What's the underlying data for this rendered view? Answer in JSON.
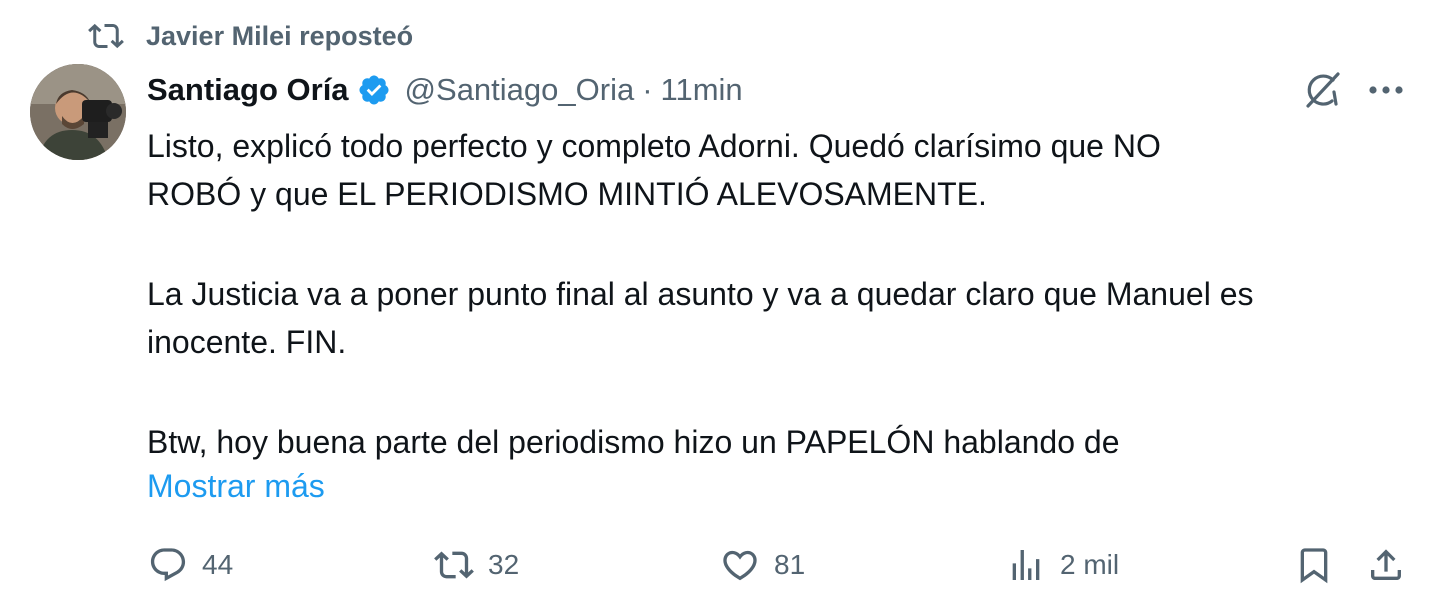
{
  "repost": {
    "icon": "repost-icon",
    "text": "Javier Milei reposteó"
  },
  "author": {
    "display_name": "Santiago Oría",
    "verified_icon": "verified-badge-icon",
    "handle": "@Santiago_Oria",
    "separator": "·",
    "time": "11min"
  },
  "tweet": {
    "lines": {
      "l1": "Listo, explicó todo perfecto y completo Adorni. Quedó clarísimo que NO",
      "l2": "ROBÓ y que EL PERIODISMO MINTIÓ ALEVOSAMENTE.",
      "l3": "La Justicia va a poner punto final al asunto y va a quedar claro que Manuel es",
      "l4": "inocente. FIN.",
      "l5": "Btw, hoy buena parte del periodismo hizo un PAPELÓN hablando de"
    },
    "show_more": "Mostrar más"
  },
  "actions": {
    "reply_count": "44",
    "repost_count": "32",
    "like_count": "81",
    "views_count": "2 mil"
  },
  "colors": {
    "text": "#0f1419",
    "secondary": "#536471",
    "accent": "#1d9bf0"
  }
}
